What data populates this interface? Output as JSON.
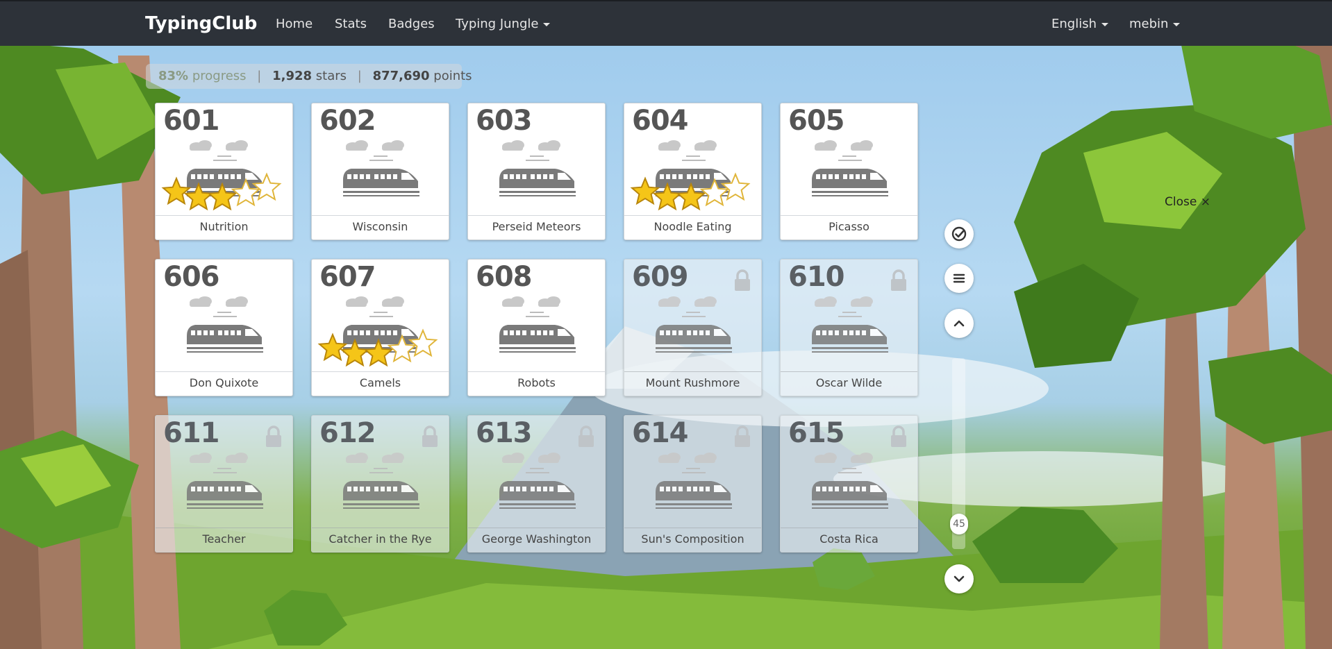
{
  "brand": "TypingClub",
  "nav": {
    "home": "Home",
    "stats": "Stats",
    "badges": "Badges",
    "typing_jungle": "Typing Jungle",
    "language": "English",
    "user": "mebin"
  },
  "progress": {
    "percent": "83%",
    "progress_label": "progress",
    "stars": "1,928",
    "stars_label": "stars",
    "points": "877,690",
    "points_label": "points",
    "separator": "|"
  },
  "lessons": [
    {
      "num": "601",
      "title": "Nutrition",
      "stars": 3,
      "locked": false
    },
    {
      "num": "602",
      "title": "Wisconsin",
      "stars": 0,
      "locked": false
    },
    {
      "num": "603",
      "title": "Perseid Meteors",
      "stars": 0,
      "locked": false
    },
    {
      "num": "604",
      "title": "Noodle Eating",
      "stars": 3,
      "locked": false
    },
    {
      "num": "605",
      "title": "Picasso",
      "stars": 0,
      "locked": false
    },
    {
      "num": "606",
      "title": "Don Quixote",
      "stars": 0,
      "locked": false
    },
    {
      "num": "607",
      "title": "Camels",
      "stars": 3,
      "locked": false
    },
    {
      "num": "608",
      "title": "Robots",
      "stars": 0,
      "locked": false
    },
    {
      "num": "609",
      "title": "Mount Rushmore",
      "stars": 0,
      "locked": true
    },
    {
      "num": "610",
      "title": "Oscar Wilde",
      "stars": 0,
      "locked": true
    },
    {
      "num": "611",
      "title": "Teacher",
      "stars": 0,
      "locked": true
    },
    {
      "num": "612",
      "title": "Catcher in the Rye",
      "stars": 0,
      "locked": true
    },
    {
      "num": "613",
      "title": "George Washington",
      "stars": 0,
      "locked": true
    },
    {
      "num": "614",
      "title": "Sun's Composition",
      "stars": 0,
      "locked": true
    },
    {
      "num": "615",
      "title": "Costa Rica",
      "stars": 0,
      "locked": true
    }
  ],
  "scroll_page": "45",
  "close_label": "Close",
  "close_glyph": "×",
  "colors": {
    "navbar": "#2d3239",
    "star_fill": "#f5c518",
    "icon_gray": "#7a7a7a"
  }
}
